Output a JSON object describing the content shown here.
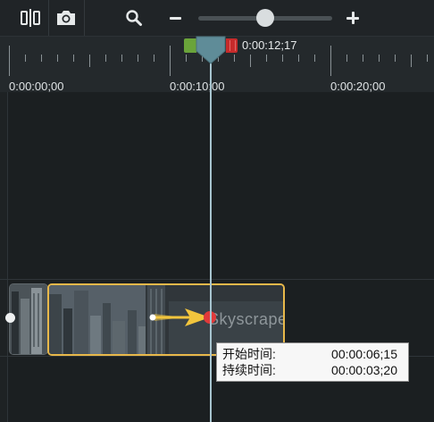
{
  "toolbar": {
    "items": [
      {
        "name": "split-icon"
      },
      {
        "name": "camera-icon"
      },
      {
        "name": "search-icon"
      },
      {
        "name": "zoom-out-icon"
      },
      {
        "name": "zoom-slider"
      },
      {
        "name": "zoom-in-icon"
      }
    ],
    "zoom_level": 0.5
  },
  "timeline": {
    "playhead_time": "0:00:12;17",
    "ruler_labels": [
      "0:00:00;00",
      "0:00:10;00",
      "0:00:20;00"
    ]
  },
  "clip": {
    "label": "Skyscrapers"
  },
  "tooltip": {
    "start_label": "开始时间:",
    "start_value": "00:00:06;15",
    "duration_label": "持续时间:",
    "duration_value": "00:00:03;20"
  },
  "colors": {
    "background": "#1a1d1f",
    "clip_selected_border": "#e8b84a",
    "playhead_green": "#6aa43a",
    "playhead_red": "#c62b2b",
    "playhead_body": "#5f8c98",
    "animation_arrow": "#f2c53d",
    "animation_end_point": "#e03a3a"
  }
}
